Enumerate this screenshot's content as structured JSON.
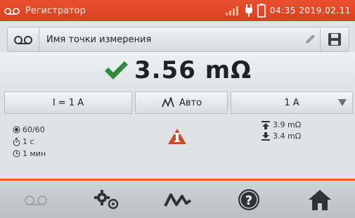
{
  "status_bar": {
    "title": "Регистратор",
    "time": "04:35 2019.02.11",
    "icons": [
      "recorder-icon",
      "signal-icon",
      "plug-icon",
      "battery-icon"
    ]
  },
  "name_bar": {
    "label": "Имя точки измерения",
    "icons": [
      "recorder-icon",
      "pencil-icon",
      "save-icon"
    ]
  },
  "result": {
    "status_icon": "checkmark-icon",
    "value": "3.56 mΩ",
    "colors": {
      "check": "#2f8a3a"
    }
  },
  "params": {
    "current": "I = 1 A",
    "mode": "Авто",
    "range": "1 A"
  },
  "info": {
    "count": "60/60",
    "duration": "1 с",
    "interval": "1 мин",
    "max_value": "3.9 mΩ",
    "min_value": "3.4 mΩ",
    "warning_icon": "warning-icon"
  },
  "toolbar": {
    "buttons": [
      "recorder-icon",
      "settings-icon",
      "graph-icon",
      "help-icon",
      "home-icon"
    ]
  },
  "colors": {
    "accent": "#e8502e",
    "warning": "#c0522e"
  }
}
